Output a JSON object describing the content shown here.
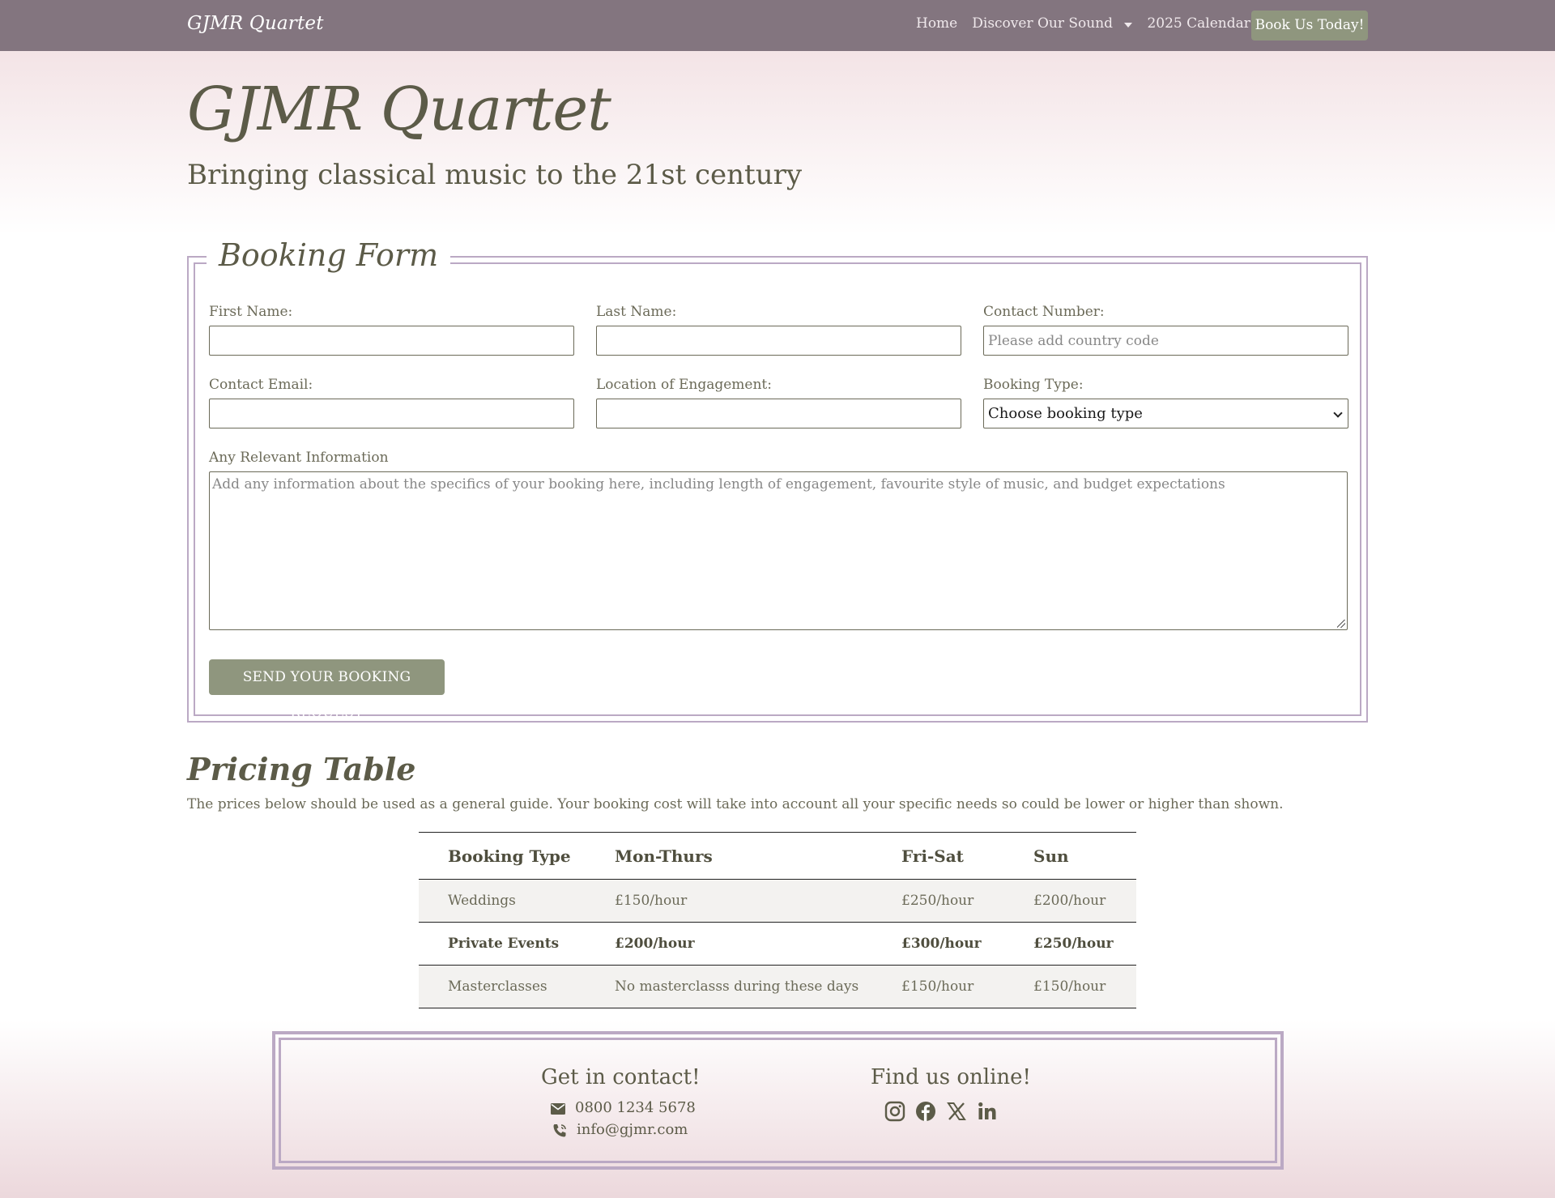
{
  "navbar": {
    "brand": "GJMR Quartet",
    "links": {
      "home": "Home",
      "discover": "Discover Our Sound",
      "calendar": "2025 Calendar"
    },
    "cta": "Book Us Today!"
  },
  "hero": {
    "title": "GJMR Quartet",
    "subtitle": "Bringing classical music to the 21st century"
  },
  "booking_form": {
    "legend": "Booking Form",
    "first_name_label": "First Name:",
    "last_name_label": "Last Name:",
    "contact_number_label": "Contact Number:",
    "contact_number_placeholder": "Please add country code",
    "contact_email_label": "Contact Email:",
    "location_label": "Location of Engagement:",
    "booking_type_label": "Booking Type:",
    "booking_type_selected": "Choose booking type",
    "info_label": "Any Relevant Information",
    "info_placeholder": "Add any information about the specifics of your booking here, including length of engagement, favourite style of music, and budget expectations",
    "submit": "SEND YOUR BOOKING REQUEST"
  },
  "pricing": {
    "title": "Pricing Table",
    "note": "The prices below should be used as a general guide. Your booking cost will take into account all your specific needs so could be lower or higher than shown.",
    "headers": [
      "Booking Type",
      "Mon-Thurs",
      "Fri-Sat",
      "Sun"
    ],
    "rows": [
      [
        "Weddings",
        "£150/hour",
        "£250/hour",
        "£200/hour"
      ],
      [
        "Private Events",
        "£200/hour",
        "£300/hour",
        "£250/hour"
      ],
      [
        "Masterclasses",
        "No masterclasss during these days",
        "£150/hour",
        "£150/hour"
      ]
    ]
  },
  "footer": {
    "contact_heading": "Get in contact!",
    "phone": "0800 1234 5678",
    "email": "info@gjmr.com",
    "online_heading": "Find us online!",
    "social_icons": [
      "instagram-icon",
      "facebook-icon",
      "x-icon",
      "linkedin-icon"
    ]
  }
}
